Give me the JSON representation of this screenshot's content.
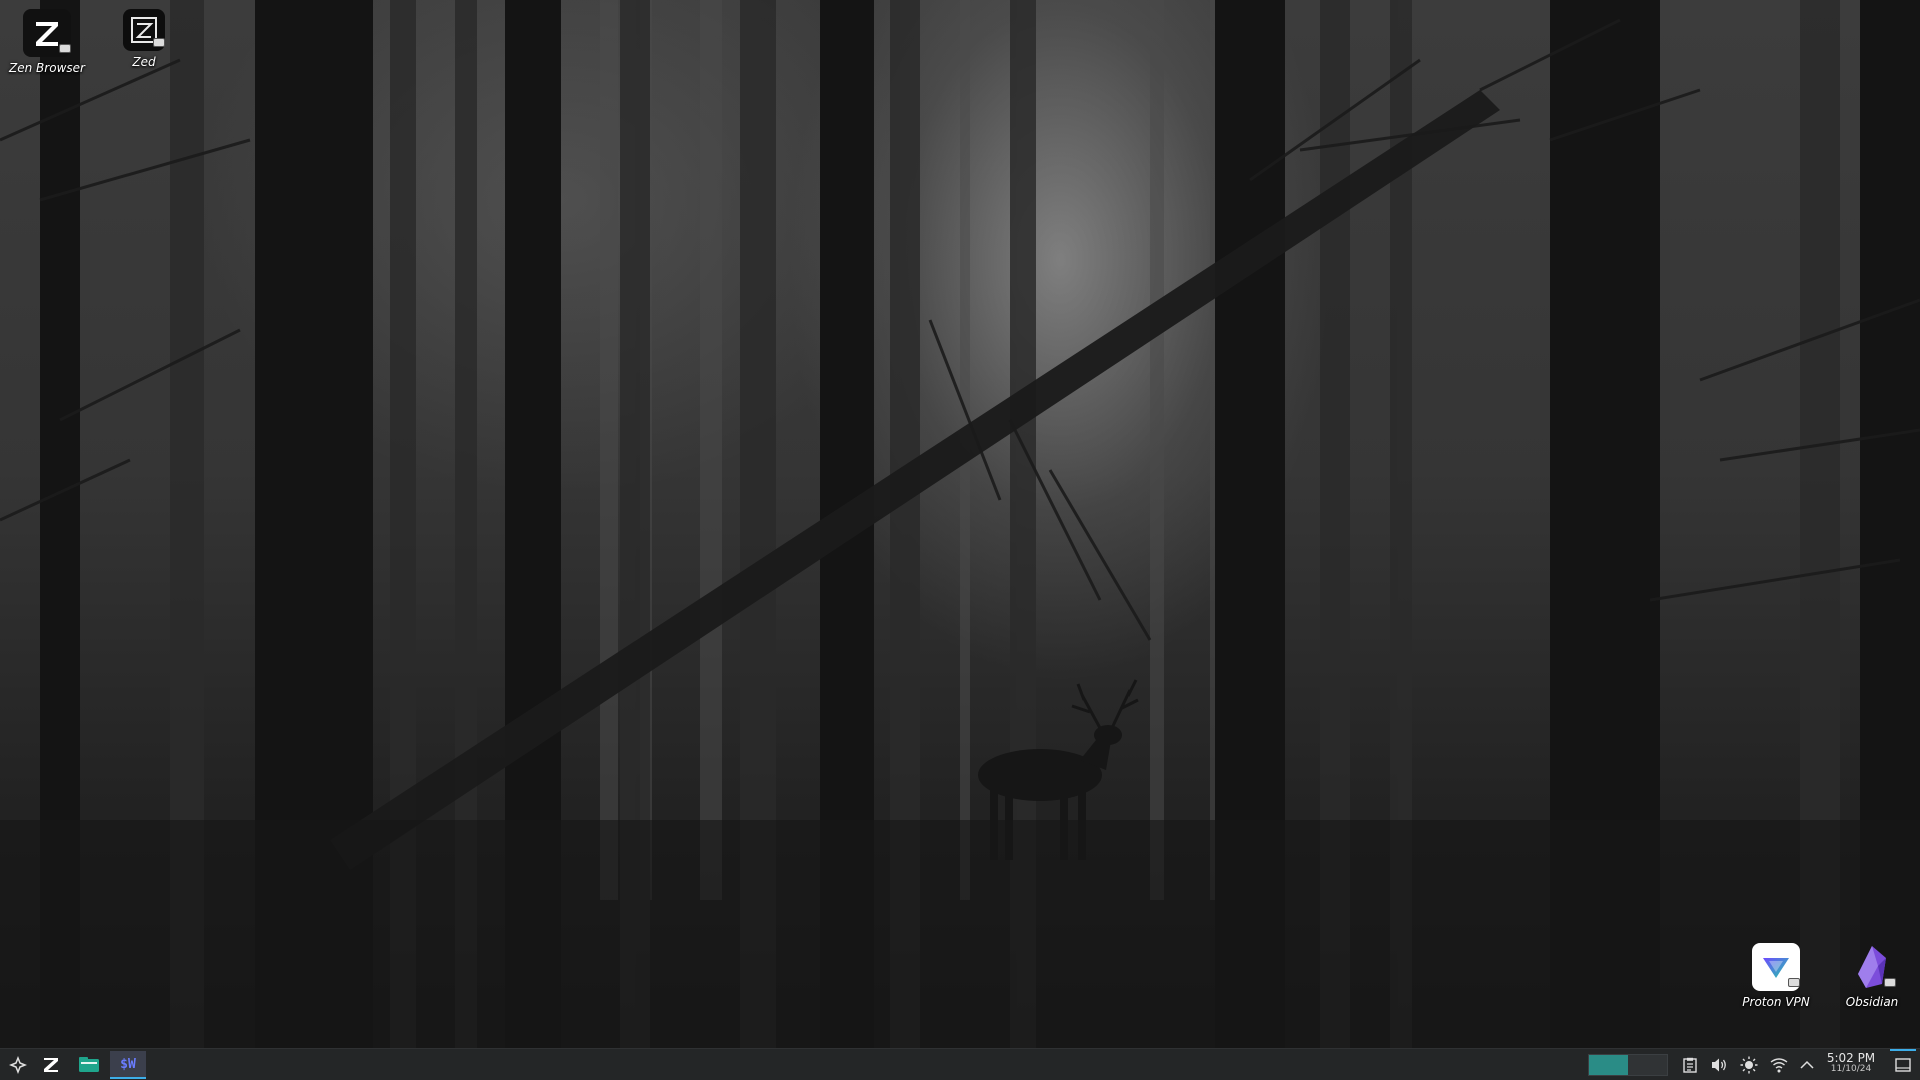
{
  "desktop": {
    "icons": [
      {
        "label": "Zen Browser",
        "icon": "zen-browser-icon"
      },
      {
        "label": "Zed",
        "icon": "zed-editor-icon"
      },
      {
        "label": "Proton VPN",
        "icon": "proton-vpn-icon"
      },
      {
        "label": "Obsidian",
        "icon": "obsidian-icon"
      }
    ]
  },
  "taskbar": {
    "launcher_icon": "app-launcher-icon",
    "pinned": [
      {
        "icon": "zen-browser-icon"
      },
      {
        "icon": "file-manager-icon"
      },
      {
        "icon": "terminal-icon",
        "text": "$W"
      }
    ],
    "pager": {
      "desktops": 2,
      "active_index": 0,
      "active_color": "#2a8c86"
    },
    "tray": [
      "clipboard-icon",
      "volume-icon",
      "brightness-icon",
      "wifi-icon",
      "chevron-up-icon"
    ],
    "clock": {
      "time": "5:02 PM",
      "date": "11/10/24"
    },
    "show_desktop_icon": "show-desktop-icon"
  },
  "colors": {
    "accent": "#3daee9",
    "taskbar_bg": "#242627",
    "obsidian_purple": "#7c4ddb",
    "proton_purple": "#6d4aff"
  }
}
